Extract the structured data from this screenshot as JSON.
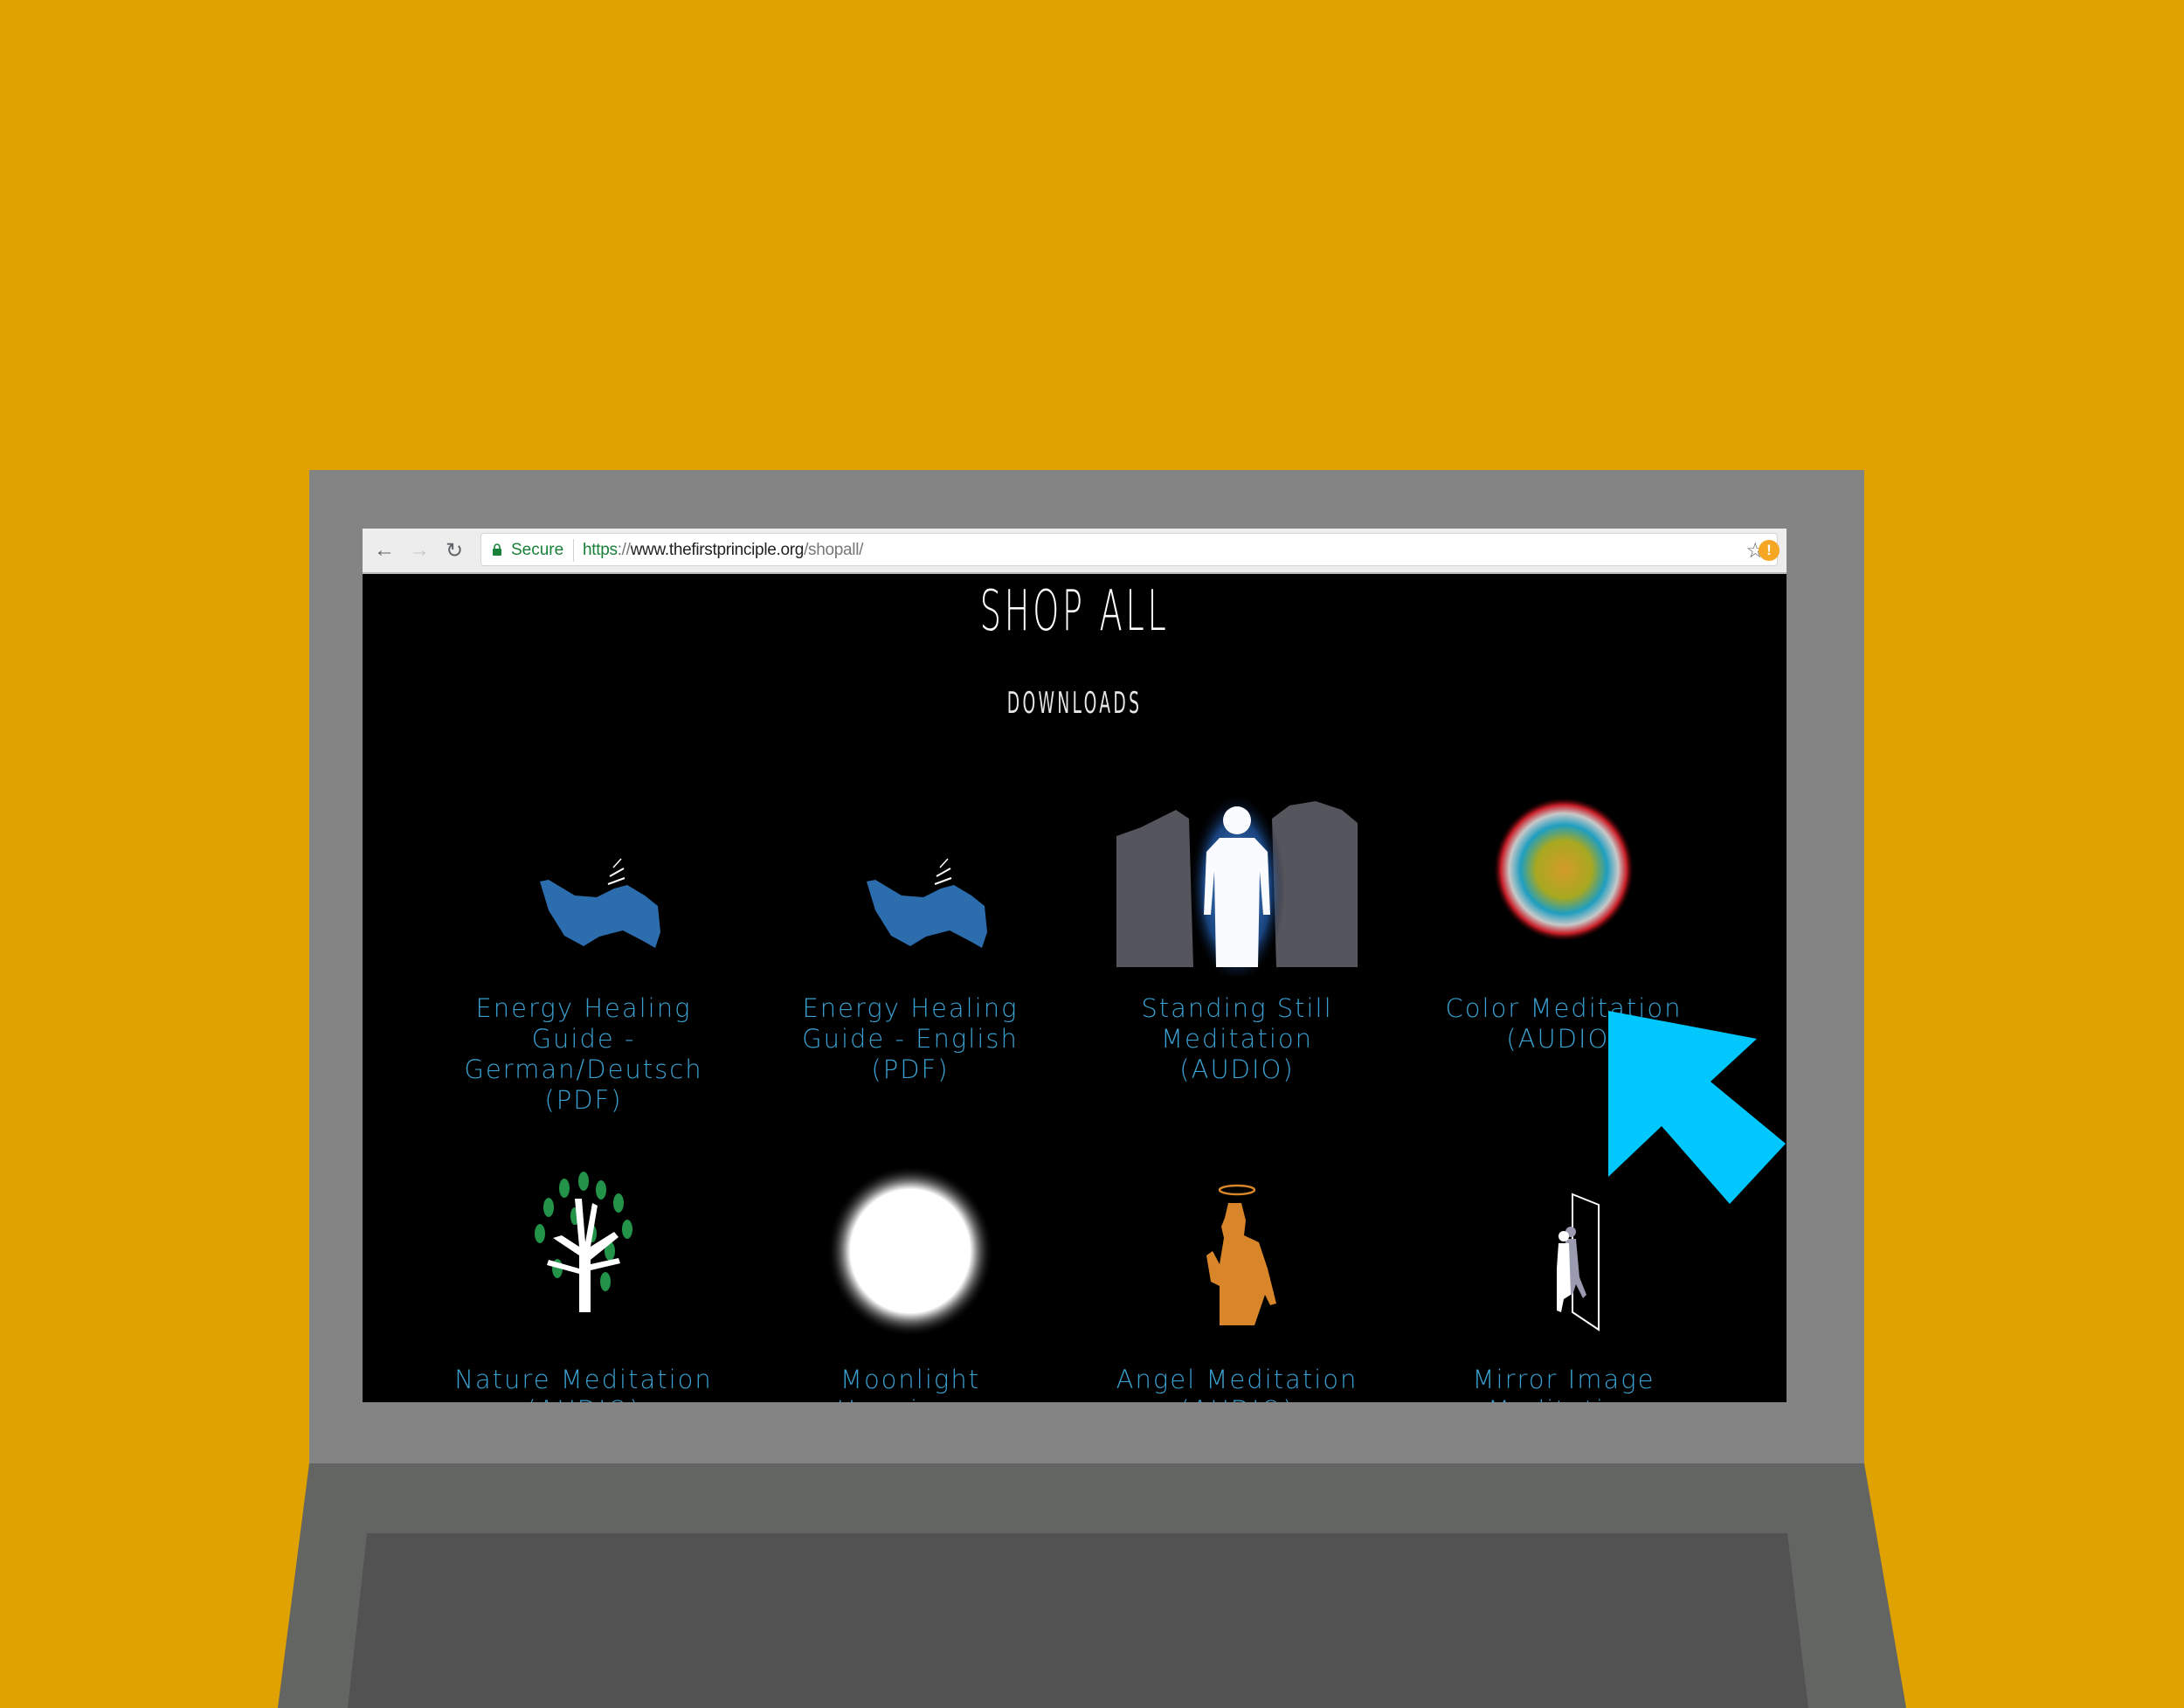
{
  "browser": {
    "nav": {
      "back_icon": "arrow-left-icon",
      "forward_icon": "arrow-right-icon",
      "reload_icon": "reload-icon"
    },
    "security_label": "Secure",
    "url_scheme": "https",
    "url_sep": "://",
    "url_host": "www.thefirstprinciple.org",
    "url_path": "/shopall/",
    "bookmark_icon": "star-icon",
    "extension_badge": "!"
  },
  "page": {
    "title": "SHOP ALL",
    "section": "DOWNLOADS",
    "products": [
      {
        "name": "Energy Healing Guide - German/Deutsch (PDF)",
        "image": "blue-hand-icon"
      },
      {
        "name": "Energy Healing Guide - English (PDF)",
        "image": "blue-hand-icon"
      },
      {
        "name": "Standing Still Meditation (AUDIO)",
        "image": "glowing-figure"
      },
      {
        "name": "Color Meditation (AUDIO)",
        "image": "color-orb"
      },
      {
        "name": "Nature Meditation (AUDIO)",
        "image": "tree-icon"
      },
      {
        "name": "Moonlight Happiness",
        "image": "moon"
      },
      {
        "name": "Angel Meditation (AUDIO)",
        "image": "angel-silhouette"
      },
      {
        "name": "Mirror Image Meditation (AUDIO)",
        "image": "mirror-figure"
      }
    ]
  },
  "colors": {
    "background": "#E0A200",
    "laptop_lid": "#848484",
    "laptop_base": "#636563",
    "keyboard_area": "#525252",
    "link": "#3AA0D0",
    "cursor": "#00C8FF"
  }
}
